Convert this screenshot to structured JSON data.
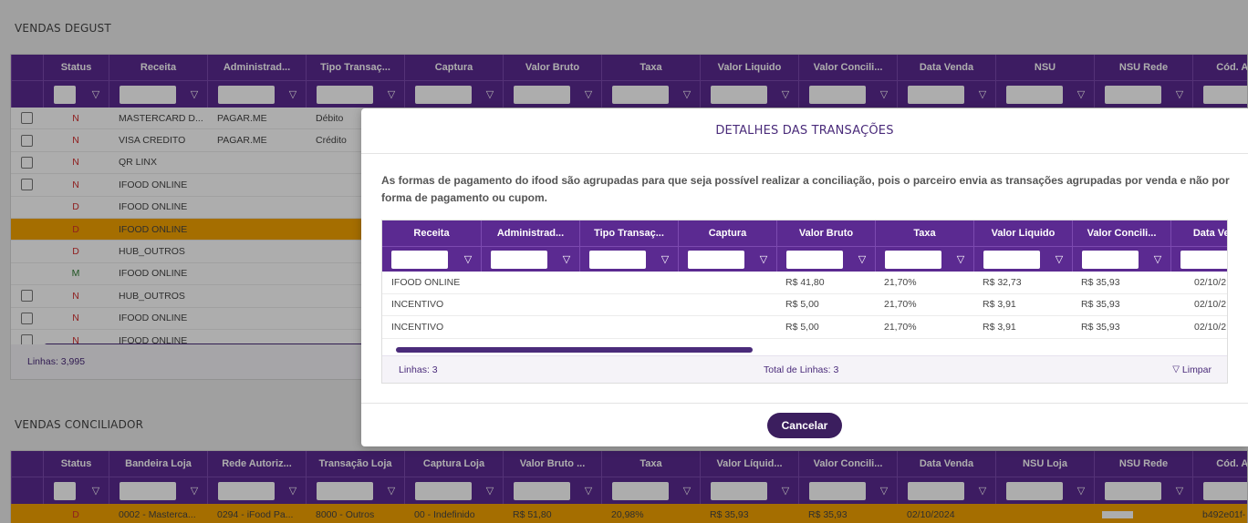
{
  "vendas_degust": {
    "title": "VENDAS DEGUST",
    "columns": [
      "Status",
      "Receita",
      "Administrad...",
      "Tipo Transaç...",
      "Captura",
      "Valor Bruto",
      "Taxa",
      "Valor Liquido",
      "Valor Concili...",
      "Data Venda",
      "NSU",
      "NSU Rede",
      "Cód. Autor"
    ],
    "rows": [
      {
        "check": true,
        "status": "N",
        "receita": "MASTERCARD D...",
        "admin": "PAGAR.ME",
        "tipo": "Débito"
      },
      {
        "check": true,
        "status": "N",
        "receita": "VISA CREDITO",
        "admin": "PAGAR.ME",
        "tipo": "Crédito"
      },
      {
        "check": true,
        "status": "N",
        "receita": "QR LINX",
        "admin": "",
        "tipo": ""
      },
      {
        "check": true,
        "status": "N",
        "receita": "IFOOD ONLINE",
        "admin": "",
        "tipo": ""
      },
      {
        "check": false,
        "status": "D",
        "receita": "IFOOD ONLINE",
        "admin": "",
        "tipo": ""
      },
      {
        "check": false,
        "status": "D",
        "receita": "IFOOD ONLINE",
        "admin": "",
        "tipo": "",
        "highlight": true
      },
      {
        "check": false,
        "status": "D",
        "receita": "HUB_OUTROS",
        "admin": "",
        "tipo": ""
      },
      {
        "check": false,
        "status": "M",
        "receita": "IFOOD ONLINE",
        "admin": "",
        "tipo": ""
      },
      {
        "check": true,
        "status": "N",
        "receita": "HUB_OUTROS",
        "admin": "",
        "tipo": ""
      },
      {
        "check": true,
        "status": "N",
        "receita": "IFOOD ONLINE",
        "admin": "",
        "tipo": ""
      },
      {
        "check": true,
        "status": "N",
        "receita": "IFOOD ONLINE",
        "admin": "",
        "tipo": ""
      }
    ],
    "footer": "Linhas: 3,995"
  },
  "vendas_conciliador": {
    "title": "VENDAS CONCILIADOR",
    "columns": [
      "Status",
      "Bandeira Loja",
      "Rede Autoriz...",
      "Transação Loja",
      "Captura Loja",
      "Valor Bruto ...",
      "Taxa",
      "Valor Líquid...",
      "Valor Concili...",
      "Data Venda",
      "NSU Loja",
      "NSU Rede",
      "Cód. Autor"
    ],
    "row": [
      "D",
      "0002 - Masterca...",
      "0294 - iFood Pa...",
      "8000 - Outros",
      "00 - Indefinido",
      "R$ 51,80",
      "20,98%",
      "R$ 35,93",
      "R$ 35,93",
      "02/10/2024",
      "",
      "",
      "b492e01f-"
    ]
  },
  "modal": {
    "title": "DETALHES DAS TRANSAÇÕES",
    "description": "As formas de pagamento do ifood são agrupadas para que seja possível realizar a conciliação, pois o parceiro envia as transações agrupadas por venda e não por forma de pagamento ou cupom.",
    "columns": [
      "Receita",
      "Administrad...",
      "Tipo Transaç...",
      "Captura",
      "Valor Bruto",
      "Taxa",
      "Valor Liquido",
      "Valor Concili...",
      "Data Venda"
    ],
    "rows": [
      [
        "IFOOD ONLINE",
        "",
        "",
        "",
        "R$ 41,80",
        "21,70%",
        "R$ 32,73",
        "R$ 35,93",
        "02/10/2"
      ],
      [
        "INCENTIVO",
        "",
        "",
        "",
        "R$ 5,00",
        "21,70%",
        "R$ 3,91",
        "R$ 35,93",
        "02/10/2"
      ],
      [
        "INCENTIVO",
        "",
        "",
        "",
        "R$ 5,00",
        "21,70%",
        "R$ 3,91",
        "R$ 35,93",
        "02/10/2"
      ]
    ],
    "footer_lines": "Linhas: 3",
    "footer_total": "Total de Linhas: 3",
    "footer_clear": "Limpar",
    "cancel_label": "Cancelar"
  },
  "colors": {
    "accent": "#5b2a91",
    "button": "#3b1e5e",
    "highlight": "#f4a300",
    "status_red": "#d32f2f",
    "status_green": "#2e7d32"
  },
  "icons": {
    "filter": "filter-icon"
  }
}
